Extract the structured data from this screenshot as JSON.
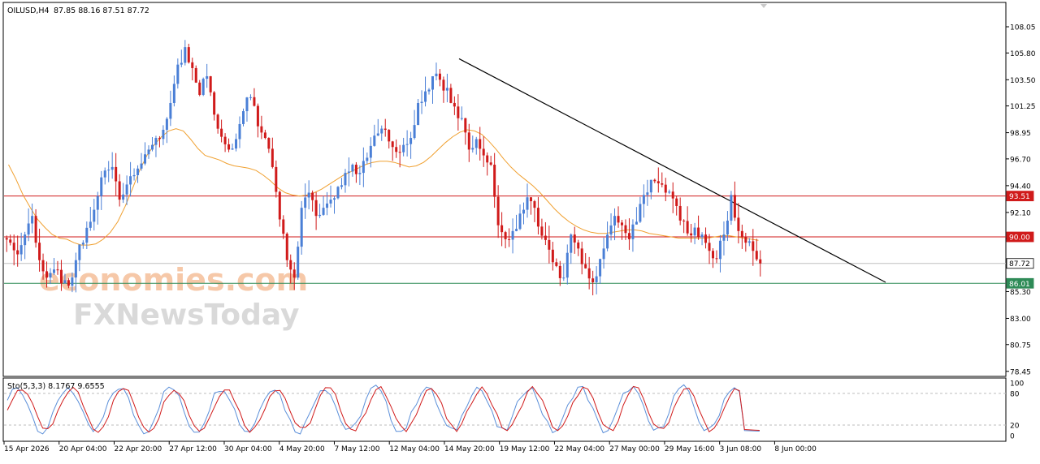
{
  "header": {
    "symbol": "OILUSD,H4",
    "ohlc": "87.85 88.16 87.51 87.72"
  },
  "indicator": {
    "label": "Sto(5,3,3) 8.1767 9.6555",
    "levels": [
      "100",
      "80",
      "20",
      "0"
    ]
  },
  "watermark": {
    "line1": "economies.com",
    "line2": "FXNewsToday"
  },
  "colors": {
    "bull": "#4a7fd6",
    "bear": "#d01a1a",
    "ma": "#f0a030",
    "resistance": "#d01a1a",
    "support": "#2e8b57",
    "stoch_main": "#5b8fd9",
    "stoch_signal": "#d01a1a",
    "trendline": "#000000"
  },
  "chart_data": {
    "type": "candlestick",
    "symbol": "OILUSD",
    "timeframe": "H4",
    "y_ticks": [
      "108.05",
      "105.80",
      "103.50",
      "101.25",
      "98.95",
      "96.70",
      "94.40",
      "92.10",
      "89.85",
      "85.30",
      "83.00",
      "80.75",
      "78.45"
    ],
    "ylim": [
      78.45,
      108.05
    ],
    "x_labels": [
      "15 Apr 2026",
      "20 Apr 04:00",
      "22 Apr 20:00",
      "27 Apr 12:00",
      "30 Apr 04:00",
      "4 May 20:00",
      "7 May 12:00",
      "12 May 04:00",
      "14 May 20:00",
      "19 May 12:00",
      "22 May 04:00",
      "27 May 00:00",
      "29 May 16:00",
      "3 Jun 08:00",
      "8 Jun 00:00"
    ],
    "price_levels": [
      {
        "value": 93.51,
        "label": "93.51",
        "kind": "resistance"
      },
      {
        "value": 90.0,
        "label": "90.00",
        "kind": "resistance"
      },
      {
        "value": 87.72,
        "label": "87.72",
        "kind": "current"
      },
      {
        "value": 86.01,
        "label": "86.01",
        "kind": "support"
      }
    ],
    "trendline": {
      "from": {
        "x": "14 May 20:00",
        "y": 105.3
      },
      "to": {
        "x": "projection",
        "y": 86.1
      }
    },
    "close_path": [
      89.5,
      88.5,
      90.2,
      91.8,
      88.0,
      86.5,
      87.2,
      86.0,
      85.8,
      88.0,
      89.5,
      91.3,
      93.5,
      95.7,
      96.0,
      93.2,
      94.5,
      95.3,
      96.3,
      97.5,
      98.5,
      99.2,
      101.5,
      104.8,
      106.3,
      104.5,
      102.2,
      103.8,
      100.5,
      98.6,
      97.5,
      98.4,
      100.8,
      102.0,
      99.5,
      98.5,
      96.0,
      91.5,
      88.0,
      86.5,
      92.5,
      93.8,
      91.8,
      92.5,
      93.2,
      94.3,
      95.5,
      96.2,
      95.5,
      96.8,
      98.7,
      99.3,
      98.2,
      97.3,
      97.9,
      98.5,
      101.5,
      102.5,
      103.8,
      103.5,
      102.8,
      101.2,
      100.2,
      97.5,
      98.4,
      97.0,
      96.2,
      91.0,
      89.8,
      90.5,
      92.0,
      93.4,
      92.5,
      90.1,
      88.9,
      87.5,
      86.5,
      90.2,
      89.0,
      87.3,
      86.1,
      88.1,
      90.2,
      91.8,
      91.0,
      89.8,
      91.3,
      93.6,
      94.9,
      94.6,
      93.8,
      93.3,
      91.4,
      90.3,
      90.8,
      90.2,
      88.8,
      88.1,
      90.2,
      93.6,
      90.5,
      89.5,
      88.8,
      87.72
    ],
    "moving_average": [
      96.2,
      95.0,
      93.6,
      92.5,
      91.5,
      90.8,
      90.2,
      89.9,
      89.8,
      89.5,
      89.3,
      89.3,
      89.4,
      89.8,
      90.4,
      91.3,
      92.6,
      94.1,
      95.7,
      97.0,
      97.9,
      98.6,
      99.1,
      99.3,
      99.1,
      98.4,
      97.6,
      97.0,
      96.8,
      96.6,
      96.3,
      96.1,
      96.0,
      95.9,
      95.7,
      95.3,
      94.8,
      94.2,
      93.8,
      93.6,
      93.5,
      93.6,
      93.8,
      94.1,
      94.5,
      94.9,
      95.3,
      95.6,
      95.9,
      96.2,
      96.4,
      96.5,
      96.5,
      96.4,
      96.2,
      96.0,
      96.1,
      96.4,
      96.9,
      97.5,
      98.1,
      98.6,
      99.0,
      99.2,
      99.1,
      98.8,
      98.2,
      97.5,
      96.7,
      96.0,
      95.4,
      94.9,
      94.4,
      93.8,
      93.1,
      92.4,
      91.8,
      91.3,
      90.9,
      90.6,
      90.4,
      90.3,
      90.3,
      90.4,
      90.5,
      90.6,
      90.6,
      90.5,
      90.3,
      90.2,
      90.1,
      90.0,
      89.9,
      89.9,
      89.9,
      89.9,
      89.9,
      90.0,
      90.1,
      90.1,
      90.0,
      89.9,
      89.8,
      89.7
    ],
    "stochastic": {
      "params": "5,3,3",
      "main": 8.1767,
      "signal": 9.6555,
      "levels": [
        20,
        80
      ],
      "ylim": [
        0,
        100
      ]
    }
  }
}
